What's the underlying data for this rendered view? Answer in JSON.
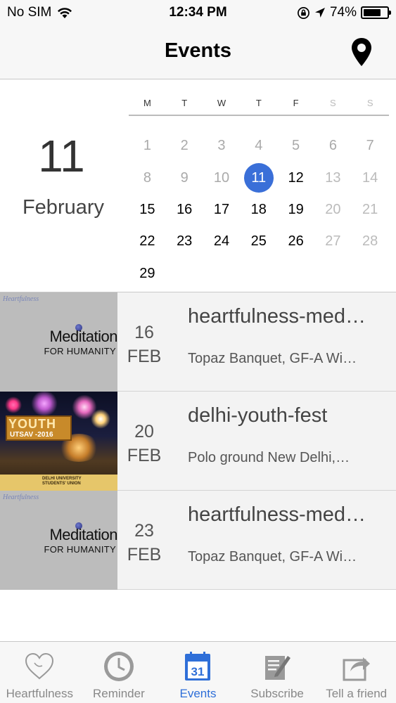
{
  "status_bar": {
    "carrier": "No SIM",
    "time": "12:34 PM",
    "battery_text": "74%",
    "battery_level": 0.74
  },
  "nav": {
    "title": "Events",
    "location_icon": "map-pin-icon"
  },
  "calendar": {
    "selected_day": "11",
    "selected_month": "February",
    "weekdays": [
      "M",
      "T",
      "W",
      "T",
      "F",
      "S",
      "S"
    ],
    "days": [
      {
        "label": "1",
        "state": "past"
      },
      {
        "label": "2",
        "state": "past"
      },
      {
        "label": "3",
        "state": "past"
      },
      {
        "label": "4",
        "state": "past"
      },
      {
        "label": "5",
        "state": "past"
      },
      {
        "label": "6",
        "state": "past"
      },
      {
        "label": "7",
        "state": "past"
      },
      {
        "label": "8",
        "state": "past"
      },
      {
        "label": "9",
        "state": "past"
      },
      {
        "label": "10",
        "state": "past"
      },
      {
        "label": "11",
        "state": "today"
      },
      {
        "label": "12",
        "state": "cur"
      },
      {
        "label": "13",
        "state": "wknd"
      },
      {
        "label": "14",
        "state": "wknd"
      },
      {
        "label": "15",
        "state": "cur"
      },
      {
        "label": "16",
        "state": "cur"
      },
      {
        "label": "17",
        "state": "cur"
      },
      {
        "label": "18",
        "state": "cur"
      },
      {
        "label": "19",
        "state": "cur"
      },
      {
        "label": "20",
        "state": "wknd"
      },
      {
        "label": "21",
        "state": "wknd"
      },
      {
        "label": "22",
        "state": "cur"
      },
      {
        "label": "23",
        "state": "cur"
      },
      {
        "label": "24",
        "state": "cur"
      },
      {
        "label": "25",
        "state": "cur"
      },
      {
        "label": "26",
        "state": "cur"
      },
      {
        "label": "27",
        "state": "wknd"
      },
      {
        "label": "28",
        "state": "wknd"
      },
      {
        "label": "29",
        "state": "cur"
      }
    ]
  },
  "events": [
    {
      "day": "16",
      "month": "FEB",
      "title": "heartfulness-med…",
      "venue": "Topaz Banquet, GF-A Wi…",
      "thumb": {
        "kind": "meditation",
        "logo": "Heartfulness",
        "line1": "Meditation",
        "line2": "FOR HUMANITY"
      }
    },
    {
      "day": "20",
      "month": "FEB",
      "title": "delhi-youth-fest",
      "venue": "Polo ground New Delhi,…",
      "thumb": {
        "kind": "youth",
        "line1": "YOUTH",
        "line2": "UTSAV -2016",
        "line3": "DELHI UNIVERSITY STUDENTS' UNION"
      }
    },
    {
      "day": "23",
      "month": "FEB",
      "title": "heartfulness-med…",
      "venue": "Topaz Banquet, GF-A Wi…",
      "thumb": {
        "kind": "meditation",
        "logo": "Heartfulness",
        "line1": "Meditation",
        "line2": "FOR HUMANITY"
      }
    }
  ],
  "tabs": [
    {
      "label": "Heartfulness",
      "icon": "heart-icon",
      "active": false
    },
    {
      "label": "Reminder",
      "icon": "clock-icon",
      "active": false
    },
    {
      "label": "Events",
      "icon": "calendar-icon",
      "active": true,
      "badge": "31"
    },
    {
      "label": "Subscribe",
      "icon": "compose-icon",
      "active": false
    },
    {
      "label": "Tell a friend",
      "icon": "share-icon",
      "active": false
    }
  ],
  "colors": {
    "accent": "#2f6fd8",
    "today_circle": "#3a6fd8"
  }
}
